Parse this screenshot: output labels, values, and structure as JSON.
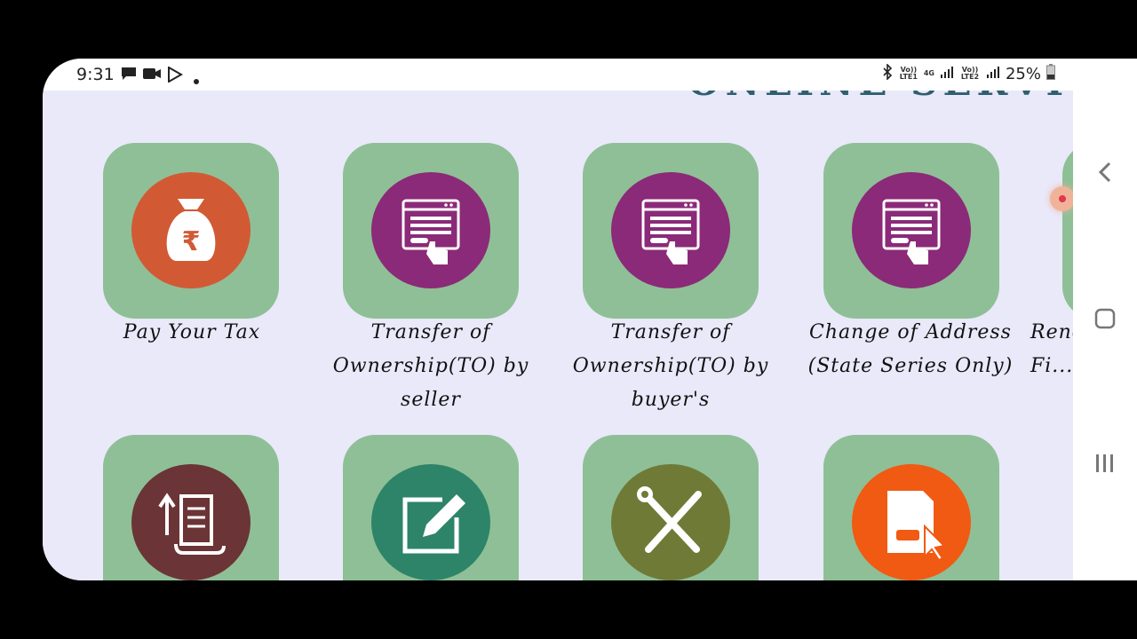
{
  "status_bar": {
    "time": "9:31",
    "volte1": "Vo)) LTE1",
    "net4g": "4G",
    "volte2": "Vo)) LTE2",
    "battery": "25%"
  },
  "page": {
    "heading": "ONLINE SERVICES"
  },
  "services": [
    {
      "label": "Pay Your Tax",
      "icon": "money-bag-icon",
      "color": "#d15a34"
    },
    {
      "label": "Transfer of Ownership(TO) by seller",
      "icon": "browser-click-icon",
      "color": "#8b2a78"
    },
    {
      "label": "Transfer of Ownership(TO) by buyer's",
      "icon": "browser-click-icon",
      "color": "#8b2a78"
    },
    {
      "label": "Change of Address (State Series Only)",
      "icon": "browser-click-icon",
      "color": "#8b2a78"
    },
    {
      "label": "Rene... Fi...",
      "icon": "partial-icon",
      "color": "#d15a34"
    },
    {
      "label": "",
      "icon": "scroll-upload-icon",
      "color": "#6b3436"
    },
    {
      "label": "",
      "icon": "edit-form-icon",
      "color": "#2e8468"
    },
    {
      "label": "",
      "icon": "tools-icon",
      "color": "#6f7a37"
    },
    {
      "label": "",
      "icon": "document-cursor-icon",
      "color": "#f05a12"
    }
  ],
  "colors": {
    "tile": "#8fbf96",
    "background": "#e9e9fa"
  }
}
